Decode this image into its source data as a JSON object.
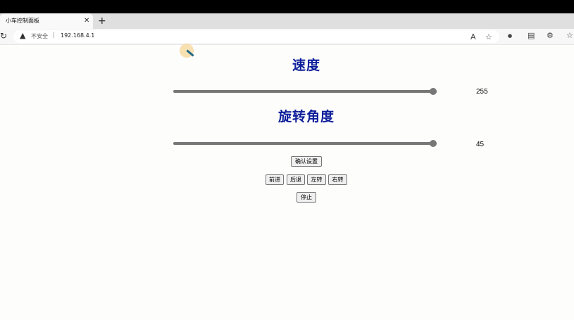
{
  "browser": {
    "tab_title": "小车控制面板",
    "tab_close": "✕",
    "new_tab": "+",
    "security_label": "不安全",
    "url": "192.168.4.1"
  },
  "page": {
    "speed_heading": "速度",
    "speed_value": "255",
    "speed_fraction": 1.0,
    "angle_heading": "旋转角度",
    "angle_value": "45",
    "angle_fraction": 1.0,
    "confirm_button": "确认设置",
    "forward_button": "前进",
    "back_button": "后退",
    "left_button": "左转",
    "right_button": "右转",
    "stop_button": "停止"
  },
  "icons": {
    "reload": "reload-icon",
    "warning": "warning-icon",
    "read_aloud": "read-aloud-icon",
    "favorite": "favorite-icon",
    "extension": "extension-icon"
  },
  "colors": {
    "heading": "#0d1e9a",
    "slider": "#777777"
  }
}
